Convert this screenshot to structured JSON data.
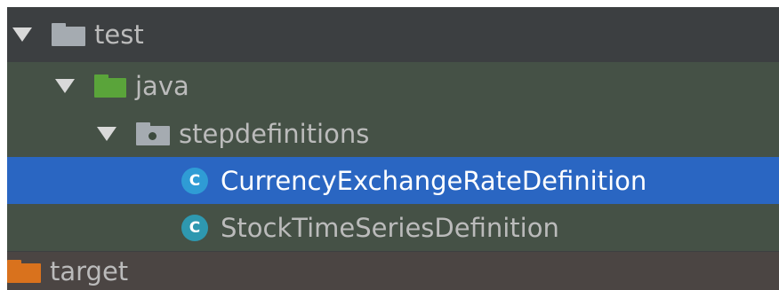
{
  "tree": {
    "items": [
      {
        "label": "test",
        "icon": "folder-icon",
        "expanded": true,
        "color": "#a5abb1"
      },
      {
        "label": "java",
        "icon": "source-folder-icon",
        "expanded": true,
        "color": "#5aa43a"
      },
      {
        "label": "stepdefinitions",
        "icon": "package-icon",
        "expanded": true,
        "color": "#a5abb1"
      },
      {
        "label": "CurrencyExchangeRateDefinition",
        "icon": "class-icon",
        "icon_letter": "C",
        "selected": true
      },
      {
        "label": "StockTimeSeriesDefinition",
        "icon": "class-icon",
        "icon_letter": "C",
        "selected": false
      },
      {
        "label": "target",
        "icon": "excluded-folder-icon",
        "expanded": false,
        "color": "#d9721d"
      }
    ]
  },
  "colors": {
    "selection": "#2a66c2",
    "test_background": "#455146",
    "excluded_background": "#4b4543",
    "background": "#3c3f41"
  }
}
